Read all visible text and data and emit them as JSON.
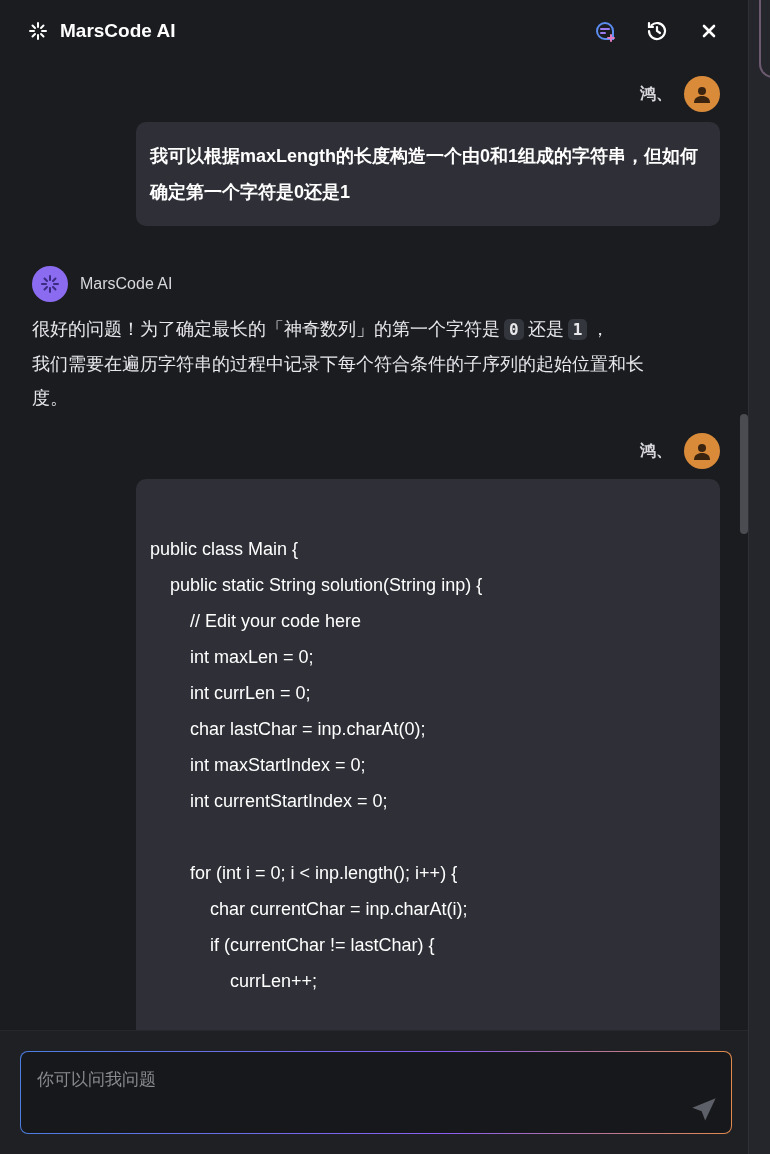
{
  "header": {
    "title": "MarsCode AI"
  },
  "messages": [
    {
      "kind": "user",
      "author": "鸿、",
      "text": "我可以根据maxLength的长度构造一个由0和1组成的字符串，但如何确定第一个字符是0还是1"
    },
    {
      "kind": "assistant",
      "author": "MarsCode AI",
      "parts": [
        {
          "kind": "text",
          "text": "很好的问题！为了确定最长的「神奇数列」的第一个字符是"
        },
        {
          "kind": "code",
          "text": "0"
        },
        {
          "kind": "text",
          "text": "还是"
        },
        {
          "kind": "code",
          "text": "1"
        },
        {
          "kind": "text",
          "text": "，"
        },
        {
          "kind": "break"
        },
        {
          "kind": "text",
          "text": "我们需要在遍历字符串的过程中记录下每个符合条件的子序列的起始位置和长度。"
        }
      ]
    },
    {
      "kind": "code",
      "author": "鸿、",
      "lines": [
        {
          "kind": "blank"
        },
        {
          "kind": "code",
          "text": "public class Main {"
        },
        {
          "kind": "code",
          "text": "    public static String solution(String inp) {"
        },
        {
          "kind": "code",
          "text": "        // Edit your code here"
        },
        {
          "kind": "code",
          "text": "        int maxLen = 0;"
        },
        {
          "kind": "code",
          "text": "        int currLen = 0;"
        },
        {
          "kind": "code",
          "text": "        char lastChar = inp.charAt(0);"
        },
        {
          "kind": "code",
          "text": "        int maxStartIndex = 0;"
        },
        {
          "kind": "code",
          "text": "        int currentStartIndex = 0;"
        },
        {
          "kind": "blank"
        },
        {
          "kind": "code",
          "text": "        for (int i = 0; i < inp.length(); i++) {"
        },
        {
          "kind": "code",
          "text": "            char currentChar = inp.charAt(i);"
        },
        {
          "kind": "code",
          "text": "            if (currentChar != lastChar) {"
        },
        {
          "kind": "code",
          "text": "                currLen++;"
        }
      ]
    }
  ],
  "composer": {
    "placeholder": "你可以问我问题"
  }
}
